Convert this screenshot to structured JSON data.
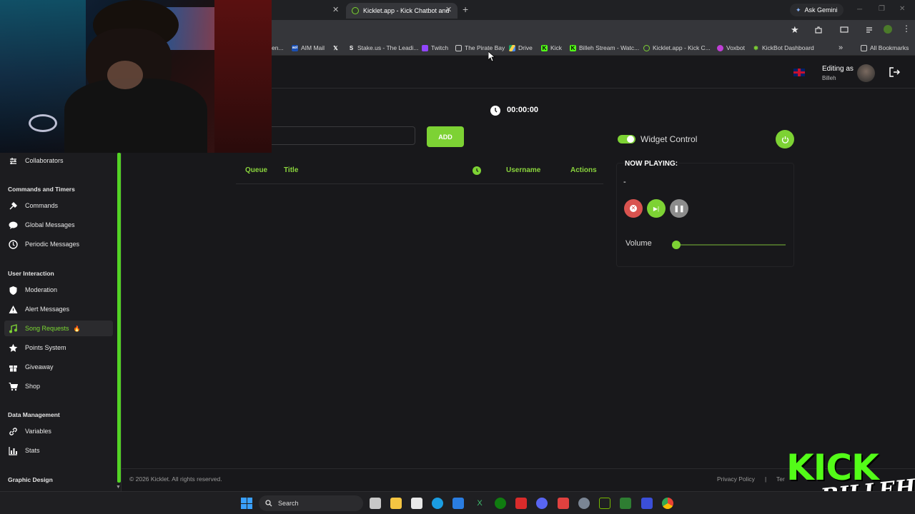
{
  "browser": {
    "tabs": [
      {
        "label": "Kicklet.app - Kick Chatbot and",
        "active": true
      }
    ],
    "new_tab_symbol": "+",
    "ask_gemini": "Ask Gemini",
    "bookmarks": [
      {
        "label": "en...",
        "icon": "page-icon"
      },
      {
        "label": "AIM Mail",
        "icon": "aol-icon"
      },
      {
        "label": "",
        "icon": "x-icon"
      },
      {
        "label": "Stake.us - The Leadi...",
        "icon": "stake-icon"
      },
      {
        "label": "Twitch",
        "icon": "twitch-icon"
      },
      {
        "label": "The Pirate Bay",
        "icon": "pirate-bay-icon"
      },
      {
        "label": "Drive",
        "icon": "drive-icon"
      },
      {
        "label": "Kick",
        "icon": "kick-icon"
      },
      {
        "label": "Billeh Stream - Watc...",
        "icon": "kick-icon"
      },
      {
        "label": "Kicklet.app - Kick C...",
        "icon": "kicklet-icon"
      },
      {
        "label": "Voxbot",
        "icon": "voxbot-icon"
      },
      {
        "label": "KickBot Dashboard",
        "icon": "kickbot-icon"
      }
    ],
    "bookmarks_overflow": "»",
    "all_bookmarks": "All Bookmarks"
  },
  "header": {
    "editing_as": "Editing as",
    "user": "Billeh",
    "language_flag": "uk-flag-icon"
  },
  "sidebar": {
    "sections": [
      {
        "title": "",
        "items": [
          {
            "label": "Collaborators",
            "icon": "collaborators-icon"
          }
        ]
      },
      {
        "title": "Commands and Timers",
        "items": [
          {
            "label": "Commands",
            "icon": "hammer-icon"
          },
          {
            "label": "Global Messages",
            "icon": "chat-icon"
          },
          {
            "label": "Periodic Messages",
            "icon": "clock-icon"
          }
        ]
      },
      {
        "title": "User Interaction",
        "items": [
          {
            "label": "Moderation",
            "icon": "shield-icon"
          },
          {
            "label": "Alert Messages",
            "icon": "warning-icon"
          },
          {
            "label": "Song Requests",
            "icon": "music-icon",
            "active": true,
            "badge": "🔥"
          },
          {
            "label": "Points System",
            "icon": "star-icon"
          },
          {
            "label": "Giveaway",
            "icon": "gift-icon"
          },
          {
            "label": "Shop",
            "icon": "cart-icon"
          }
        ]
      },
      {
        "title": "Data Management",
        "items": [
          {
            "label": "Variables",
            "icon": "link-icon"
          },
          {
            "label": "Stats",
            "icon": "chart-icon"
          }
        ]
      },
      {
        "title": "Graphic Design",
        "items": []
      }
    ]
  },
  "main": {
    "timer": "00:00:00",
    "add_input_value": "",
    "add_button": "ADD",
    "table_headers": {
      "queue": "Queue",
      "title": "Title",
      "username": "Username",
      "actions": "Actions"
    },
    "widget_control_label": "Widget Control",
    "widget_enabled": true,
    "now_playing_label": "NOW PLAYING:",
    "now_playing_value": "-",
    "volume_label": "Volume",
    "volume_level": 0.03
  },
  "footer": {
    "copyright": "© 2026 Kicklet. All rights reserved.",
    "privacy": "Privacy Policy",
    "separator": "|",
    "terms": "Ter"
  },
  "taskbar": {
    "search": "Search"
  },
  "overlay": {
    "brand_top": "KICK",
    "brand_bottom": "BILLEH"
  },
  "colors": {
    "accent": "#7dd234",
    "danger": "#d9534f",
    "muted_button": "#8c8c8c"
  }
}
